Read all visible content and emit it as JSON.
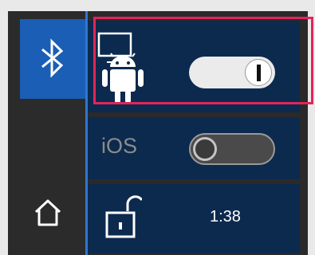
{
  "sidebar": {
    "bluetooth_icon": "bluetooth-icon",
    "home_icon": "home-icon"
  },
  "rows": {
    "android": {
      "icon": "android-icon",
      "toggle_on": true
    },
    "ios": {
      "label": "iOS",
      "toggle_on": false
    },
    "lock": {
      "icon": "unlocked-padlock-icon",
      "time": "1:38"
    }
  },
  "colors": {
    "bluetooth_tile": "#1a5eb5",
    "row_background": "#0c2a4e",
    "highlight_border": "#e2245a",
    "divider": "#2f77d0"
  }
}
